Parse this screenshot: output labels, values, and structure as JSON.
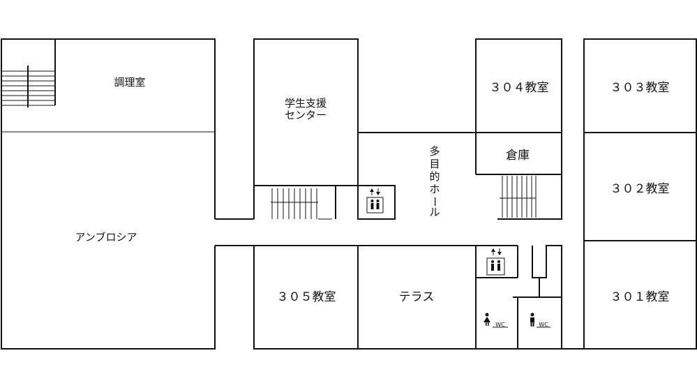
{
  "rooms": {
    "cooking": "調理室",
    "ambrosia": "アンブロシア",
    "student_support_line1": "学生支援",
    "student_support_line2": "センター",
    "room304": "３０４教室",
    "room303": "３０３教室",
    "storage": "倉庫",
    "room302": "３０２教室",
    "room301": "３０１教室",
    "room305": "３０５教室",
    "terrace": "テラス",
    "hall_c1": "多",
    "hall_c2": "目",
    "hall_c3": "的",
    "hall_c4": "ホ",
    "hall_c5": "ー",
    "hall_c6": "ル"
  },
  "restrooms": {
    "women_label": "WC",
    "men_label": "WC"
  },
  "icons": {
    "elevator": "elevator-icon",
    "stairs": "stairs-icon",
    "women_restroom": "women-restroom-icon",
    "men_restroom": "men-restroom-icon"
  }
}
